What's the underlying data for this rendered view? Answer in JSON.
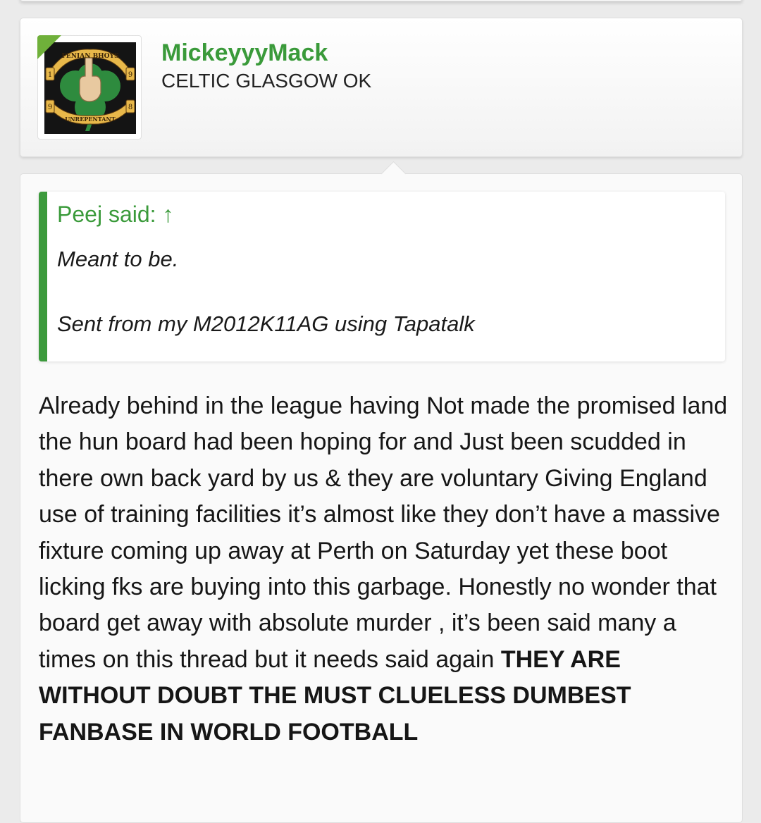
{
  "user": {
    "name": "MickeyyyMack",
    "title": "CELTIC GLASGOW OK",
    "avatar": {
      "icon": "fenian-bhoys-avatar-icon",
      "banner_top": "FENIAN BHOYS",
      "banner_bottom": "UNREPENTANT",
      "digits": [
        "1",
        "9",
        "9",
        "8"
      ]
    },
    "status_color": "#6fb03a"
  },
  "quote": {
    "author_line": "Peej said: ↑",
    "line1": "Meant to be.",
    "line2": "Sent from my M2012K11AG using Tapatalk"
  },
  "post": {
    "text": "Already behind in the league having Not made the promised land the hun board had been hoping for and Just been scudded in there own back yard by us & they are voluntary Giving England use of training facilities it’s almost like they don’t have a massive fixture coming up away at Perth on Saturday yet these boot licking fks are buying into this garbage. Honestly no wonder that board get away with absolute murder , it’s been said many a times on this thread but it needs said again ",
    "bold_text": "THEY ARE WITHOUT DOUBT THE MUST CLUELESS DUMBEST FANBASE IN WORLD FOOTBALL"
  },
  "colors": {
    "accent_green": "#3a9a3a",
    "quote_bar": "#3c9a3c",
    "background": "#ebebeb"
  }
}
